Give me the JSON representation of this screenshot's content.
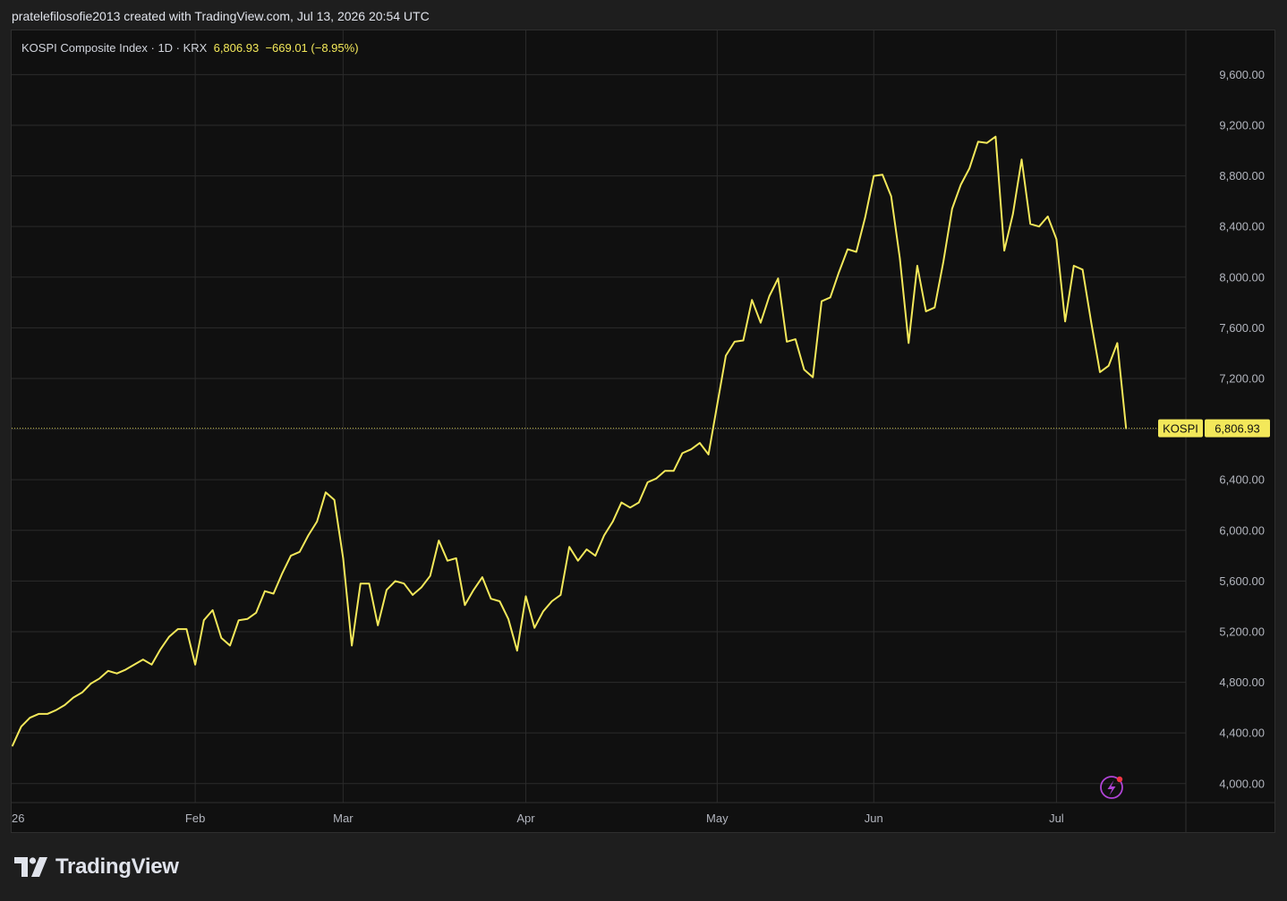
{
  "header": {
    "attribution": "pratelefilosofie2013 created with TradingView.com, Jul 13, 2026 20:54 UTC"
  },
  "legend": {
    "symbol_text": "KOSPI Composite Index · 1D · KRX",
    "last": "6,806.93",
    "change": "−669.01",
    "change_pct": "(−8.95%)"
  },
  "price_label": {
    "ticker": "KOSPI",
    "value": "6,806.93"
  },
  "footer": {
    "brand": "TradingView"
  },
  "colors": {
    "line": "#f3e85a",
    "background": "#101010",
    "grid": "#2b2b2b",
    "label_bg": "#f3e85a",
    "label_text": "#111111",
    "alert_icon": "#b044d6",
    "alert_dot": "#f23645"
  },
  "chart_data": {
    "type": "line",
    "title": "KOSPI Composite Index · 1D · KRX",
    "xlabel": "",
    "ylabel": "",
    "ylim": [
      3850,
      9850
    ],
    "yticks": [
      4000,
      4400,
      4800,
      5200,
      5600,
      6000,
      6400,
      6800,
      7200,
      7600,
      8000,
      8400,
      8800,
      9200,
      9600
    ],
    "ytick_labels": [
      "4,000.00",
      "4,400.00",
      "4,800.00",
      "5,200.00",
      "5,600.00",
      "6,000.00",
      "6,400.00",
      "6,800.00",
      "7,200.00",
      "7,600.00",
      "8,000.00",
      "8,400.00",
      "8,800.00",
      "9,200.00",
      "9,600.00"
    ],
    "xticks": [
      {
        "label": "26",
        "index": 0
      },
      {
        "label": "Feb",
        "index": 21
      },
      {
        "label": "Mar",
        "index": 38
      },
      {
        "label": "Apr",
        "index": 59
      },
      {
        "label": "May",
        "index": 81
      },
      {
        "label": "Jun",
        "index": 99
      },
      {
        "label": "Jul",
        "index": 120
      }
    ],
    "grid": true,
    "last_value": 6806.93,
    "series": [
      {
        "values": [
          4300,
          4450,
          4520,
          4550,
          4550,
          4580,
          4620,
          4680,
          4720,
          4790,
          4830,
          4890,
          4870,
          4900,
          4940,
          4980,
          4940,
          5060,
          5160,
          5220,
          5220,
          4940,
          5290,
          5370,
          5150,
          5090,
          5290,
          5300,
          5350,
          5520,
          5500,
          5660,
          5800,
          5830,
          5960,
          6070,
          6300,
          6240,
          5780,
          5090,
          5580,
          5580,
          5250,
          5530,
          5600,
          5580,
          5490,
          5550,
          5640,
          5920,
          5760,
          5780,
          5410,
          5530,
          5630,
          5460,
          5440,
          5300,
          5050,
          5480,
          5230,
          5360,
          5440,
          5490,
          5870,
          5760,
          5850,
          5800,
          5960,
          6070,
          6220,
          6180,
          6220,
          6380,
          6410,
          6470,
          6470,
          6610,
          6640,
          6690,
          6600,
          6990,
          7380,
          7490,
          7500,
          7820,
          7640,
          7850,
          7990,
          7490,
          7510,
          7270,
          7210,
          7810,
          7840,
          8040,
          8220,
          8200,
          8470,
          8800,
          8810,
          8640,
          8150,
          7480,
          8090,
          7730,
          7760,
          8120,
          8540,
          8730,
          8860,
          9070,
          9060,
          9110,
          8210,
          8500,
          8930,
          8420,
          8400,
          8480,
          8300,
          7650,
          8090,
          8060,
          7640,
          7250,
          7300,
          7480,
          6806.93
        ]
      }
    ]
  }
}
